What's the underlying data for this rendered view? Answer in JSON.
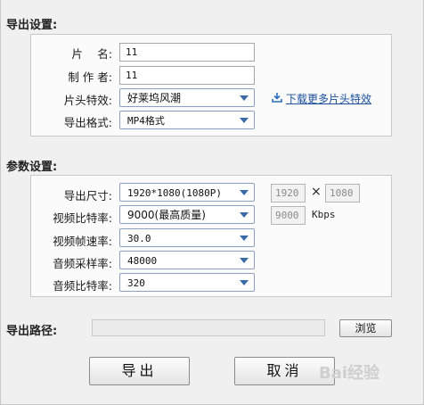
{
  "export_settings": {
    "title": "导出设置:",
    "name_label": "片　 名:",
    "name_value": "11",
    "author_label": "制 作 者:",
    "author_value": "11",
    "intro_label": "片头特效:",
    "intro_value": "好莱坞风潮",
    "download_link": "下载更多片头特效",
    "format_label": "导出格式:",
    "format_value": "MP4格式"
  },
  "param_settings": {
    "title": "参数设置:",
    "size_label": "导出尺寸:",
    "size_value": "1920*1080(1080P)",
    "width_value": "1920",
    "times_symbol": "×",
    "height_value": "1080",
    "vbitrate_label": "视频比特率:",
    "vbitrate_value": "9000(最高质量)",
    "vbitrate_box": "9000",
    "vbitrate_unit": "Kbps",
    "framerate_label": "视频帧速率:",
    "framerate_value": "30.0",
    "samplerate_label": "音频采样率:",
    "samplerate_value": "48000",
    "abitrate_label": "音频比特率:",
    "abitrate_value": "320"
  },
  "output_path": {
    "label": "导出路径:",
    "value": "",
    "browse_label": "浏览"
  },
  "actions": {
    "export_label": "导出",
    "cancel_label": "取消"
  },
  "watermark": {
    "text": "Bai经验"
  },
  "colors": {
    "accent": "#3a6aa8",
    "link": "#1a4f9c",
    "background": "#f0f0f0"
  }
}
